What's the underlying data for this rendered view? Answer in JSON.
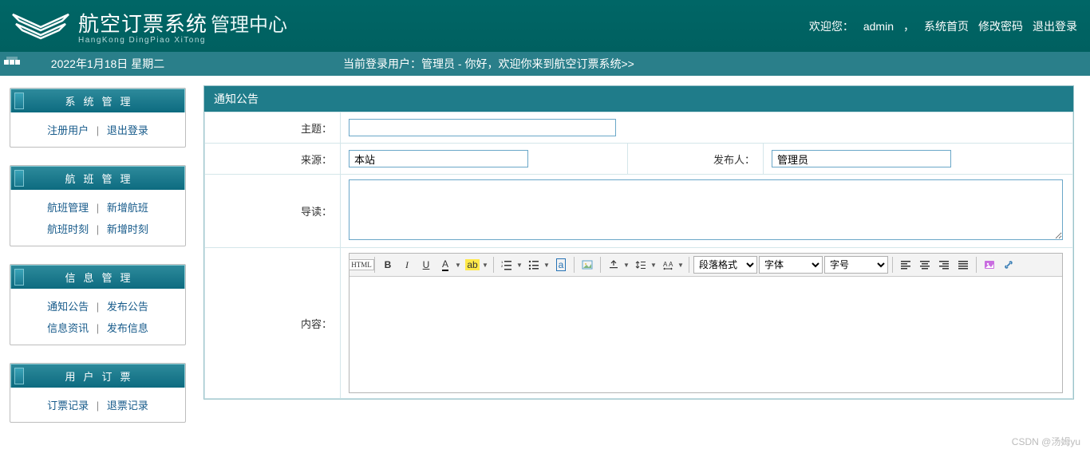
{
  "header": {
    "title_cn": "航空订票系统",
    "title_sub": "管理中心",
    "title_pinyin": "HangKong DingPiao XiTong",
    "welcome_prefix": "欢迎您：",
    "username": "admin",
    "comma": "，",
    "nav_home": "系统首页",
    "nav_pwd": "修改密码",
    "nav_logout": "退出登录"
  },
  "infobar": {
    "date": "2022年1月18日 星期二",
    "msg": "当前登录用户：管理员 - 你好，欢迎你来到航空订票系统>>"
  },
  "sidebar": {
    "g1": {
      "title": "系统管理",
      "a": "注册用户",
      "b": "退出登录"
    },
    "g2": {
      "title": "航班管理",
      "a": "航班管理",
      "b": "新增航班",
      "c": "航班时刻",
      "d": "新增时刻"
    },
    "g3": {
      "title": "信息管理",
      "a": "通知公告",
      "b": "发布公告",
      "c": "信息资讯",
      "d": "发布信息"
    },
    "g4": {
      "title": "用户订票",
      "a": "订票记录",
      "b": "退票记录"
    }
  },
  "panel": {
    "title": "通知公告"
  },
  "form": {
    "subject_label": "主题：",
    "subject_value": "",
    "source_label": "来源：",
    "source_value": "本站",
    "publisher_label": "发布人：",
    "publisher_value": "管理员",
    "summary_label": "导读：",
    "summary_value": "",
    "content_label": "内容："
  },
  "editor": {
    "html_label": "HTML",
    "format_sel": "段落格式",
    "font_sel": "字体",
    "size_sel": "字号"
  },
  "sep": "|",
  "watermark": "CSDN @汤姆yu"
}
